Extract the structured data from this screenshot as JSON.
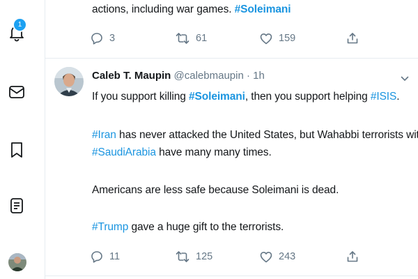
{
  "nav": {
    "notifications_badge": "1",
    "items": [
      {
        "icon": "bell-icon"
      },
      {
        "icon": "envelope-icon"
      },
      {
        "icon": "bookmark-icon"
      },
      {
        "icon": "list-icon"
      }
    ]
  },
  "tweet_previous": {
    "text_before": "actions, including war games. ",
    "hashtag": "#Soleimani",
    "replies": "3",
    "retweets": "61",
    "likes": "159"
  },
  "tweet": {
    "display_name": "Caleb T. Maupin",
    "handle": "@calebmaupin",
    "separator": "·",
    "time": "1h",
    "line1": {
      "a": "If you support killing ",
      "tag1": "#Soleimani",
      "b": ", then you support helping ",
      "tag2": "#ISIS",
      "c": "."
    },
    "line2": {
      "tag": "#Iran",
      "text": " has never attacked the United States, but Wahabbi terrorists with ties to"
    },
    "line3": {
      "tag": "#SaudiArabia",
      "text": " have many many times."
    },
    "line4": "Americans are less safe because Soleimani is dead.",
    "line5": {
      "tag": "#Trump",
      "text": " gave a huge gift to the terrorists."
    },
    "replies": "11",
    "retweets": "125",
    "likes": "243"
  },
  "colors": {
    "accent": "#1da1f2",
    "link": "#1b95e0",
    "muted": "#657786",
    "divider": "#e6ecf0"
  }
}
